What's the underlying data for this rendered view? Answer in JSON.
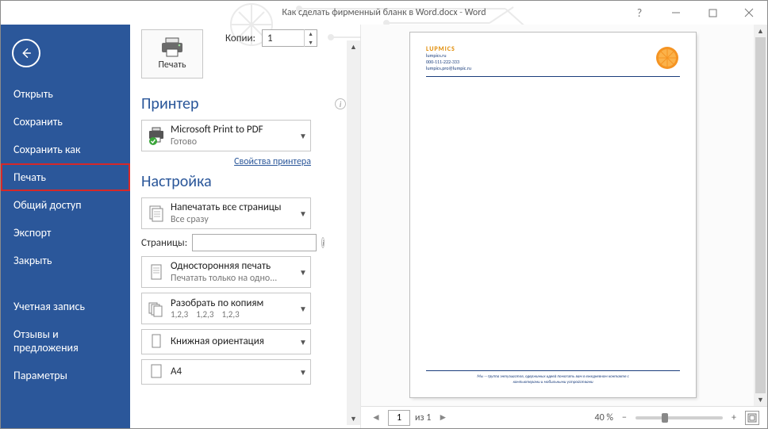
{
  "titlebar": {
    "doc_title": "Как сделать фирменный бланк в Word.docx",
    "app": "Word",
    "help_label": "?"
  },
  "sidebar": {
    "items": [
      {
        "label": "Открыть"
      },
      {
        "label": "Сохранить"
      },
      {
        "label": "Сохранить как"
      },
      {
        "label": "Печать"
      },
      {
        "label": "Общий доступ"
      },
      {
        "label": "Экспорт"
      },
      {
        "label": "Закрыть"
      }
    ],
    "extra": [
      {
        "label": "Учетная запись"
      },
      {
        "label": "Отзывы и предложения"
      },
      {
        "label": "Параметры"
      }
    ]
  },
  "print": {
    "big_button": "Печать",
    "copies_label": "Копии:",
    "copies_value": "1",
    "printer_heading": "Принтер",
    "printer_name": "Microsoft Print to PDF",
    "printer_status": "Готово",
    "printer_props": "Свойства принтера",
    "settings_heading": "Настройка",
    "print_all": {
      "l1": "Напечатать все страницы",
      "l2": "Все сразу"
    },
    "pages_label": "Страницы:",
    "pages_value": "",
    "duplex": {
      "l1": "Односторонняя печать",
      "l2": "Печатать только на одно..."
    },
    "collate": {
      "l1": "Разобрать по копиям",
      "n1": "1,2,3",
      "n2": "1,2,3",
      "n3": "1,2,3"
    },
    "orient": {
      "l1": "Книжная ориентация"
    },
    "paper": {
      "l1": "A4"
    }
  },
  "preview": {
    "brand": "LUPMICS",
    "brand_site": "lumpics.ru",
    "brand_phone": "000-111-222-333",
    "brand_email": "lumpics.pro@lumpic.ru",
    "footer1": "Мы —группа энтузиастов, одержимых идеей помогать вам в ежедневном контакте с",
    "footer2": "компьютерами и мобильными устройствами",
    "page_current": "1",
    "page_of_label": "из 1",
    "zoom_label": "40 %"
  }
}
